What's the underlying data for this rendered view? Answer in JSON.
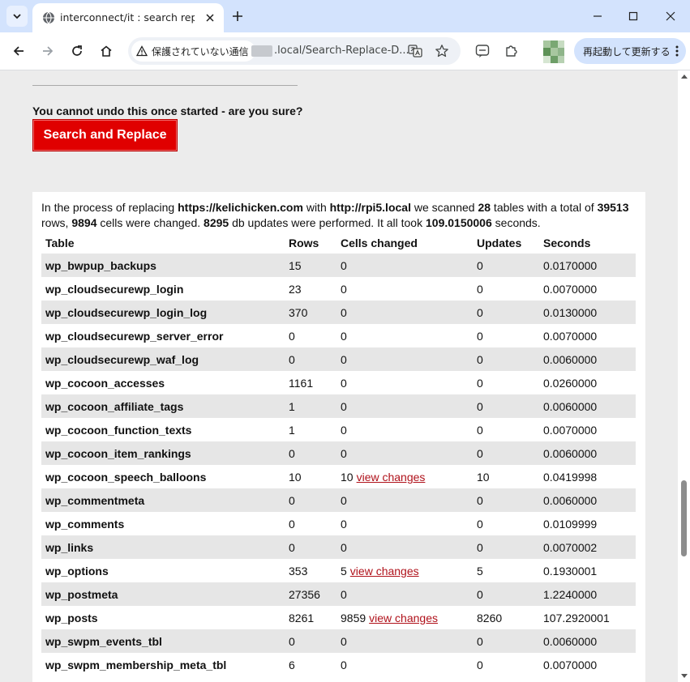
{
  "browser": {
    "tab_title": "interconnect/it : search replace",
    "security_label": "保護されていない通信",
    "url": ".local/Search-Replace-D...",
    "update_button": "再起動して更新する"
  },
  "page": {
    "warning": "You cannot undo this once started - are you sure?",
    "submit_button": "Search and Replace",
    "summary": {
      "t1": "In the process of replacing ",
      "search": "https://kelichicken.com",
      "t2": " with ",
      "replace": "http://rpi5.local",
      "t3": " we scanned ",
      "tables": "28",
      "t4": " tables with a total of ",
      "rows": "39513",
      "t5": " rows, ",
      "cells": "9894",
      "t6": " cells were changed. ",
      "updates": "8295",
      "t7": " db updates were performed. It all took ",
      "seconds": "109.0150006",
      "t8": " seconds."
    },
    "columns": [
      "Table",
      "Rows",
      "Cells changed",
      "Updates",
      "Seconds"
    ],
    "view_changes_label": "view changes",
    "table_rows": [
      {
        "table": "wp_bwpup_backups",
        "rows": "15",
        "cells": "0",
        "link": false,
        "updates": "0",
        "seconds": "0.0170000"
      },
      {
        "table": "wp_cloudsecurewp_login",
        "rows": "23",
        "cells": "0",
        "link": false,
        "updates": "0",
        "seconds": "0.0070000"
      },
      {
        "table": "wp_cloudsecurewp_login_log",
        "rows": "370",
        "cells": "0",
        "link": false,
        "updates": "0",
        "seconds": "0.0130000"
      },
      {
        "table": "wp_cloudsecurewp_server_error",
        "rows": "0",
        "cells": "0",
        "link": false,
        "updates": "0",
        "seconds": "0.0070000"
      },
      {
        "table": "wp_cloudsecurewp_waf_log",
        "rows": "0",
        "cells": "0",
        "link": false,
        "updates": "0",
        "seconds": "0.0060000"
      },
      {
        "table": "wp_cocoon_accesses",
        "rows": "1161",
        "cells": "0",
        "link": false,
        "updates": "0",
        "seconds": "0.0260000"
      },
      {
        "table": "wp_cocoon_affiliate_tags",
        "rows": "1",
        "cells": "0",
        "link": false,
        "updates": "0",
        "seconds": "0.0060000"
      },
      {
        "table": "wp_cocoon_function_texts",
        "rows": "1",
        "cells": "0",
        "link": false,
        "updates": "0",
        "seconds": "0.0070000"
      },
      {
        "table": "wp_cocoon_item_rankings",
        "rows": "0",
        "cells": "0",
        "link": false,
        "updates": "0",
        "seconds": "0.0060000"
      },
      {
        "table": "wp_cocoon_speech_balloons",
        "rows": "10",
        "cells": "10",
        "link": true,
        "updates": "10",
        "seconds": "0.0419998"
      },
      {
        "table": "wp_commentmeta",
        "rows": "0",
        "cells": "0",
        "link": false,
        "updates": "0",
        "seconds": "0.0060000"
      },
      {
        "table": "wp_comments",
        "rows": "0",
        "cells": "0",
        "link": false,
        "updates": "0",
        "seconds": "0.0109999"
      },
      {
        "table": "wp_links",
        "rows": "0",
        "cells": "0",
        "link": false,
        "updates": "0",
        "seconds": "0.0070002"
      },
      {
        "table": "wp_options",
        "rows": "353",
        "cells": "5",
        "link": true,
        "updates": "5",
        "seconds": "0.1930001"
      },
      {
        "table": "wp_postmeta",
        "rows": "27356",
        "cells": "0",
        "link": false,
        "updates": "0",
        "seconds": "1.2240000"
      },
      {
        "table": "wp_posts",
        "rows": "8261",
        "cells": "9859",
        "link": true,
        "updates": "8260",
        "seconds": "107.2920001"
      },
      {
        "table": "wp_swpm_events_tbl",
        "rows": "0",
        "cells": "0",
        "link": false,
        "updates": "0",
        "seconds": "0.0060000"
      },
      {
        "table": "wp_swpm_membership_meta_tbl",
        "rows": "6",
        "cells": "0",
        "link": false,
        "updates": "0",
        "seconds": "0.0070000"
      }
    ]
  },
  "colors": {
    "button_red": "#e00000",
    "link_red": "#b0121b",
    "row_shade": "#e6e6e6",
    "page_bg": "#ececec"
  }
}
